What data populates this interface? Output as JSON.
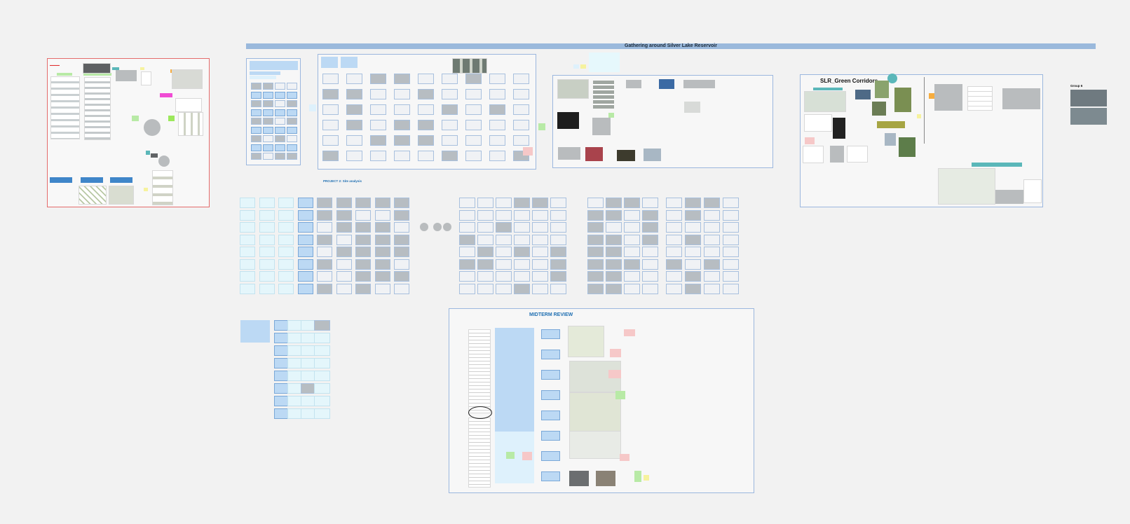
{
  "canvas": {
    "background": "#f2f2f2"
  },
  "board": {
    "banner_title": "Gathering around Silver Lake Reservoir",
    "project2_heading": "PROJECT 2: Site analysis",
    "midterm_heading": "MIDTERM REVIEW",
    "green_corridors_heading": "SLR_Green Corridors",
    "group_label": "Group 6"
  },
  "colors": {
    "frame_blue": "#7da2d6",
    "frame_red": "#e46b6b",
    "banner": "#9ab9dc",
    "sticky_blue": "#bcd9f4",
    "sticky_pink": "#f6c8c8",
    "sticky_green": "#b8eaa6",
    "sticky_yellow": "#f6f29e",
    "sticky_orange": "#f7ad3f",
    "sticky_magenta": "#f04cd4",
    "sticky_teal": "#5bb7b9"
  },
  "icons": {
    "sticky": "sticky-note-icon",
    "image": "image-thumbnail-icon",
    "document": "document-icon"
  }
}
